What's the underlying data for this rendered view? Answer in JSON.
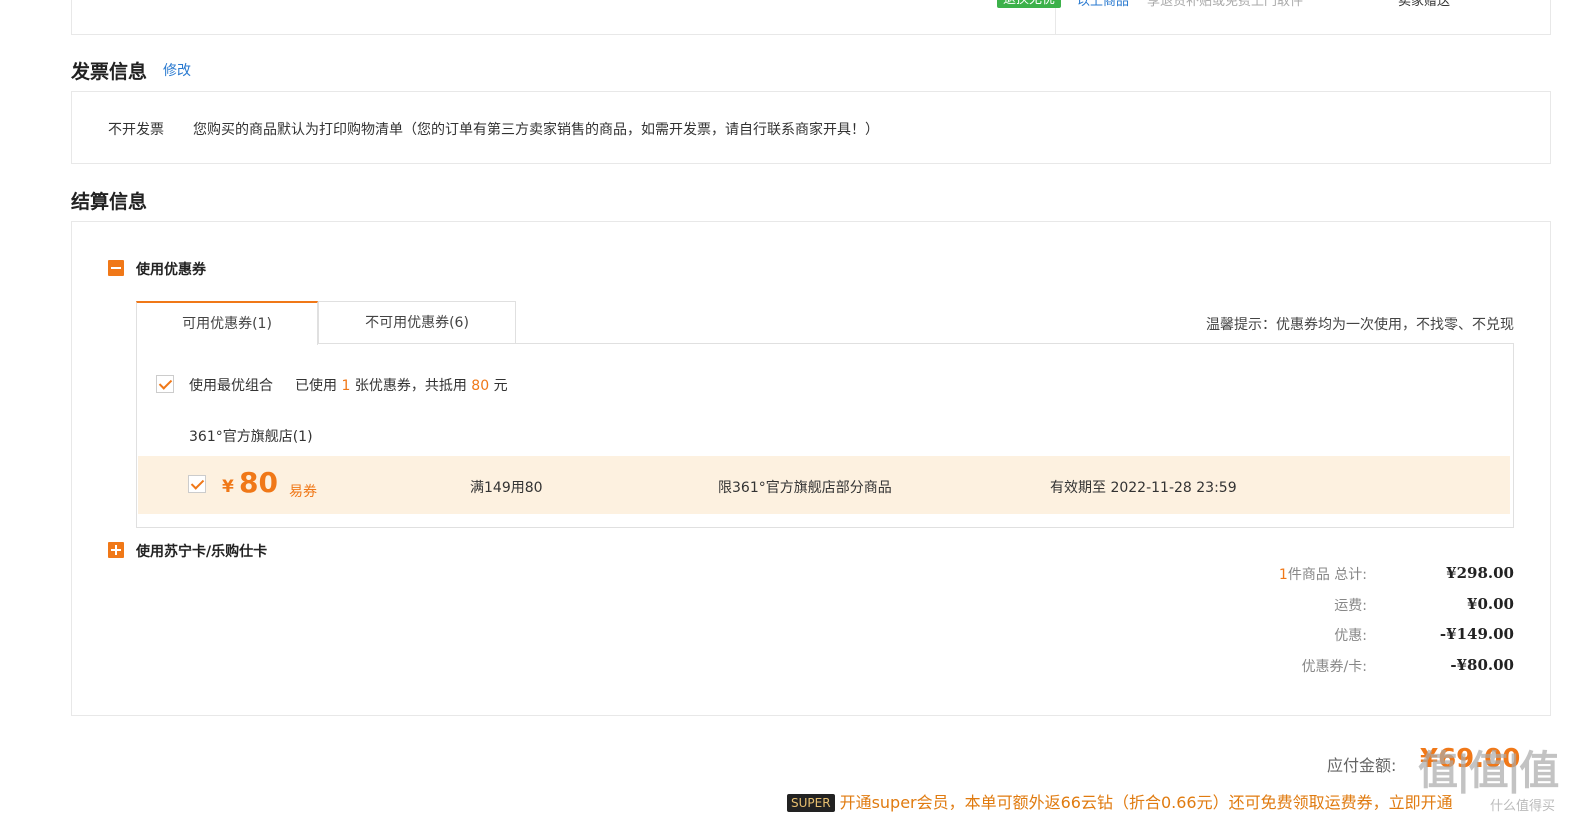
{
  "top_strip": {
    "badge": "退换无忧",
    "link": "以上商品",
    "note": "享退货补贴或免费上门取件",
    "right": "卖家赠送"
  },
  "invoice": {
    "title": "发票信息",
    "edit_label": "修改",
    "type": "不开发票",
    "description": "您购买的商品默认为打印购物清单（您的订单有第三方卖家销售的商品，如需开发票，请自行联系商家开具！）"
  },
  "settlement": {
    "title": "结算信息",
    "coupon_section_label": "使用优惠券",
    "tabs": [
      {
        "label": "可用优惠券(1)"
      },
      {
        "label": "不可用优惠券(6)"
      }
    ],
    "tip": "温馨提示：优惠券均为一次使用，不找零、不兑现",
    "best_combo_label": "使用最优组合",
    "used_prefix": "已使用",
    "used_count": "1",
    "used_middle": "张优惠券，共抵用",
    "used_amount": "80",
    "used_suffix": "元",
    "store_name": "361°官方旗舰店(1)",
    "coupon": {
      "yen": "¥",
      "amount": "80",
      "kind": "易券",
      "condition": "满149用80",
      "scope": "限361°官方旗舰店部分商品",
      "expiry": "有效期至 2022-11-28 23:59"
    },
    "card_section_label": "使用苏宁卡/乐购仕卡"
  },
  "summary": {
    "items_count": "1",
    "items_label": "件商品 总计:",
    "items_total": "¥298.00",
    "shipping_label": "运费:",
    "shipping_value": "¥0.00",
    "discount_label": "优惠:",
    "discount_value": "-¥149.00",
    "coupon_label": "优惠券/卡:",
    "coupon_value": "-¥80.00"
  },
  "payable": {
    "label": "应付金额:",
    "value": "¥69.00"
  },
  "super_promo": {
    "badge": "SUPER",
    "text": "开通super会员，本单可额外返66云钻（折合0.66元）还可免费领取运费券，立即开通"
  },
  "watermark": {
    "main": "值|值|值",
    "sub": "什么值得买"
  }
}
